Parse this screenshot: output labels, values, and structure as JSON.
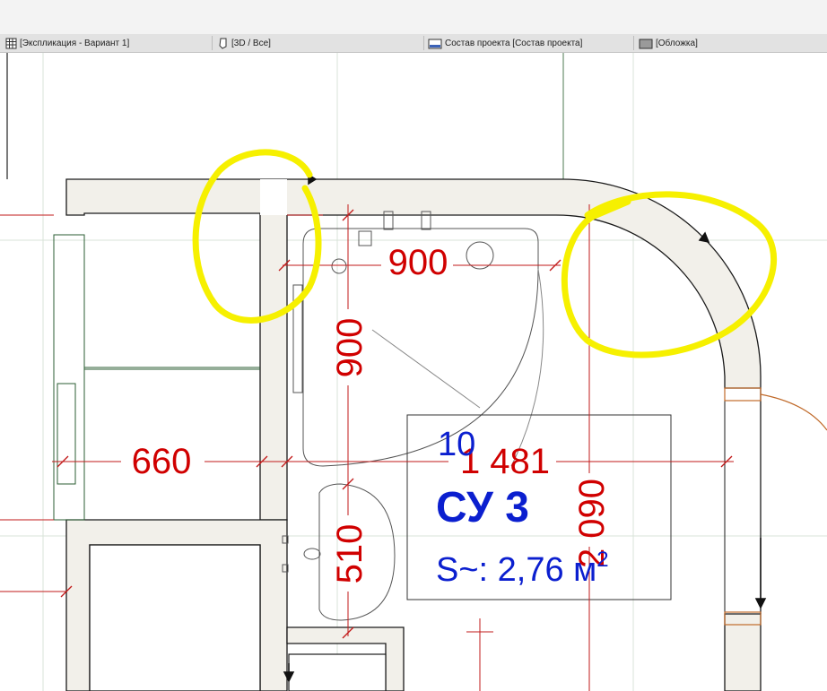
{
  "tabs": [
    {
      "label": "[Экспликация - Вариант 1]",
      "icon": "table-grid-icon"
    },
    {
      "label": "[3D / Все]",
      "icon": "3d-view-icon"
    },
    {
      "label": "Состав проекта [Состав проекта]",
      "icon": "layout-sheet-icon"
    },
    {
      "label": "[Обложка]",
      "icon": "cover-sheet-icon"
    }
  ],
  "dimensions": {
    "top_width": "900",
    "shower_depth": "900",
    "left_width": "660",
    "room_width": "1 481",
    "sink_depth": "510",
    "room_depth": "2 090"
  },
  "zone": {
    "number": "10",
    "name": "СУ 3",
    "area_prefix": "S~: 2,76 м",
    "area_sup": "2"
  },
  "colors": {
    "dimension": "#d00000",
    "zone_text": "#0b1fcf",
    "wall_fill": "#f2f0ea",
    "highlight": "#f6f000"
  }
}
